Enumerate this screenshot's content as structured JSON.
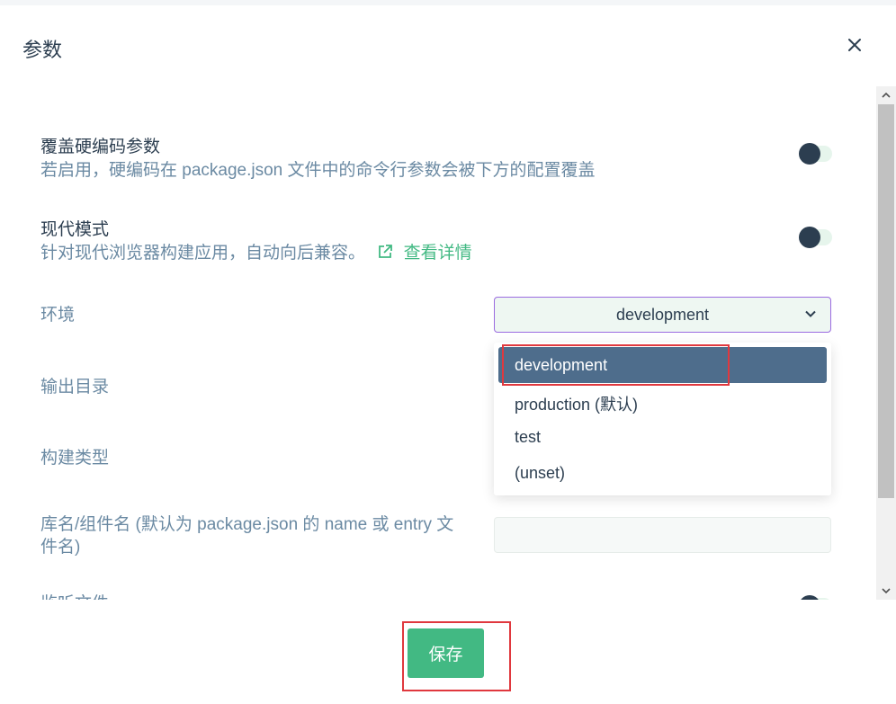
{
  "dialog": {
    "title": "参数",
    "close_icon": "close-icon"
  },
  "colors": {
    "accent": "#42b983",
    "text": "#2c3e50",
    "muted": "#6b8aa3",
    "selected_option_bg": "#4e6d8c",
    "highlight": "#e0383e"
  },
  "settings": {
    "override": {
      "label": "覆盖硬编码参数",
      "description": "若启用，硬编码在 package.json 文件中的命令行参数会被下方的配置覆盖",
      "enabled": false
    },
    "modern": {
      "label": "现代模式",
      "description": "针对现代浏览器构建应用，自动向后兼容。",
      "link_label": "查看详情",
      "link_icon": "external-link-icon",
      "enabled": false
    }
  },
  "fields": {
    "environment": {
      "label": "环境",
      "value": "development",
      "options": [
        "development",
        "production (默认)",
        "test",
        "(unset)"
      ],
      "selected_index": 0
    },
    "output_dir": {
      "label": "输出目录"
    },
    "build_type": {
      "label": "构建类型"
    },
    "lib_name": {
      "label": "库名/组件名 (默认为 package.json 的 name 或 entry 文件名)",
      "value": ""
    },
    "watch": {
      "label": "监听文件"
    }
  },
  "footer": {
    "save_label": "保存"
  }
}
